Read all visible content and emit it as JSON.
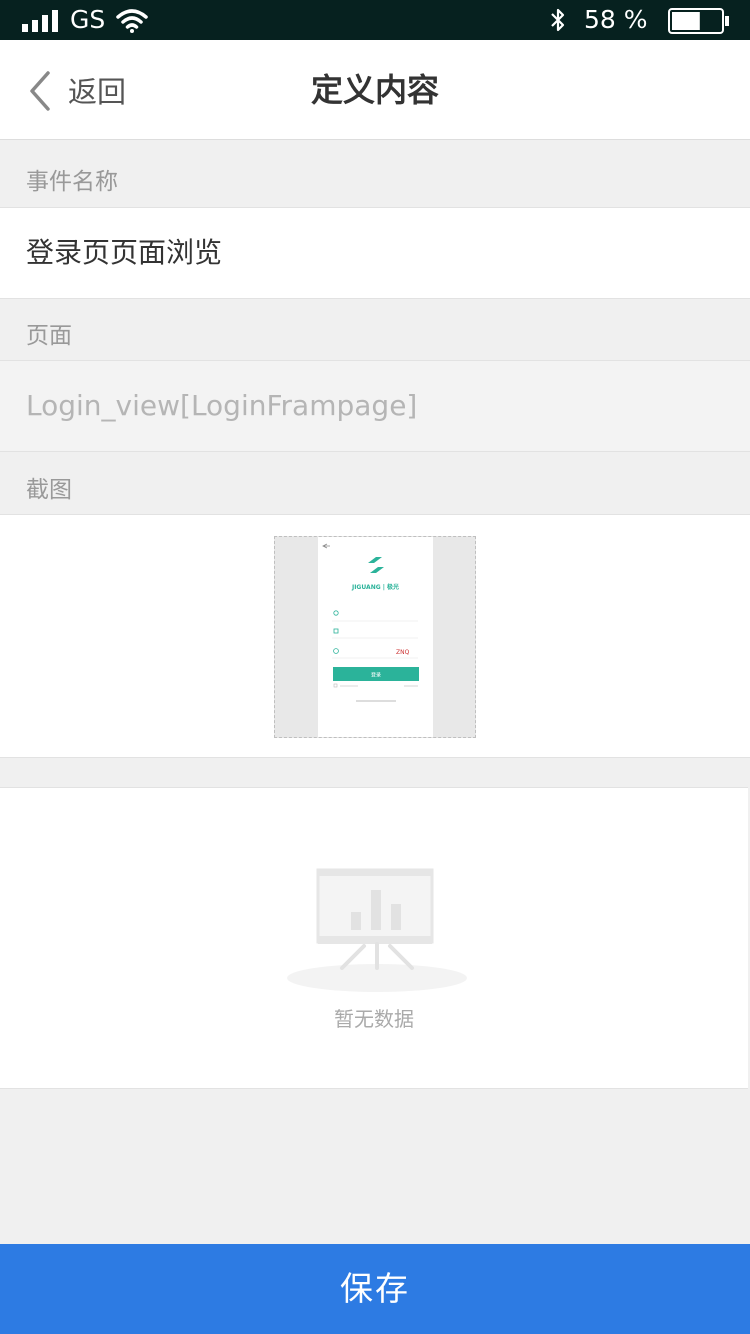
{
  "status_bar": {
    "carrier": "GS",
    "battery_text": "58 %",
    "battery_level": 0.58,
    "icons": [
      "signal-icon",
      "wifi-icon",
      "bluetooth-icon",
      "battery-icon"
    ]
  },
  "nav": {
    "back_label": "返回",
    "title": "定义内容"
  },
  "fields": {
    "event_name_label": "事件名称",
    "event_name_value": "登录页页面浏览",
    "page_label": "页面",
    "page_value": "Login_view[LoginFrampage]",
    "screenshot_label": "截图"
  },
  "screenshot_thumb": {
    "logo_text": "JIGUANG | 极光",
    "captcha_text": "ZNQ",
    "login_button": "登录",
    "accent_color": "#2bb39a"
  },
  "empty_state": {
    "text": "暂无数据",
    "icon": "empty-chart-icon"
  },
  "footer": {
    "save_label": "保存"
  },
  "colors": {
    "primary": "#2d7be3",
    "status_bar_bg": "#06211f",
    "page_bg": "#f0f0f0"
  }
}
